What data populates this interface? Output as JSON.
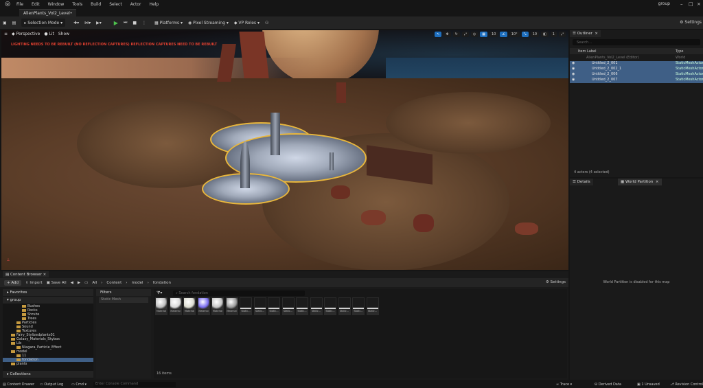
{
  "menu": [
    "File",
    "Edit",
    "Window",
    "Tools",
    "Build",
    "Select",
    "Actor",
    "Help"
  ],
  "top_right": {
    "group": "group"
  },
  "tab": {
    "level": "AlienPlants_Vol2_Level•"
  },
  "toolbar": {
    "selection_mode": "Selection Mode",
    "platforms": "Platforms",
    "pixel_streaming": "Pixel Streaming",
    "vp_roles": "VP Roles",
    "settings": "Settings"
  },
  "viewport": {
    "perspective": "Perspective",
    "lit": "Lit",
    "show": "Show",
    "warning": "LIGHTING NEEDS TO BE REBUILT (NO REFLECTION CAPTURES) REFLECTION CAPTURES NEED TO BE REBUILT",
    "grid_snap": "10",
    "rot_snap": "10°",
    "scale_snap": "10",
    "cam_speed": "1"
  },
  "outliner": {
    "title": "Outliner",
    "search_placeholder": "Search...",
    "col_label": "Item Label",
    "col_type": "Type",
    "world": "AlienPlants_Vol2_Level (Editor)",
    "world_type": "World",
    "rows": [
      {
        "name": "Untitled_2_001",
        "type": "StaticMeshActor"
      },
      {
        "name": "Untitled_2_002_1",
        "type": "StaticMeshActor"
      },
      {
        "name": "Untitled_2_006",
        "type": "StaticMeshActor"
      },
      {
        "name": "Untitled_2_007",
        "type": "StaticMeshActor"
      }
    ],
    "count": "4 actors (4 selected)"
  },
  "details": {
    "tab1": "Details",
    "tab2": "World Partition",
    "message": "World Partition is disabled for this map"
  },
  "content_browser": {
    "tab": "Content Browser",
    "add": "+ Add",
    "import": "Import",
    "save_all": "Save All",
    "path": [
      "All",
      "Content",
      "model",
      "fondation"
    ],
    "settings": "Settings",
    "favorites": "Favorites",
    "group": "group",
    "collections": "Collections",
    "filters": "Filters",
    "filter_item": "Static Mesh",
    "search_placeholder": "Search fondation",
    "items_count": "16 items",
    "tree": [
      {
        "label": "Bushes",
        "indent": 3
      },
      {
        "label": "Rocks",
        "indent": 3
      },
      {
        "label": "Shrubs",
        "indent": 3
      },
      {
        "label": "Trees",
        "indent": 3
      },
      {
        "label": "Particles",
        "indent": 2
      },
      {
        "label": "Sound",
        "indent": 2
      },
      {
        "label": "Textures",
        "indent": 2
      },
      {
        "label": "Fairy_Stylizedplants01",
        "indent": 1
      },
      {
        "label": "Galaxy_Materials_Skybox",
        "indent": 1
      },
      {
        "label": "Lib",
        "indent": 1
      },
      {
        "label": "Niagara_Particle_Effect",
        "indent": 2
      },
      {
        "label": "model",
        "indent": 1
      },
      {
        "label": "11",
        "indent": 2
      },
      {
        "label": "fondation",
        "indent": 2
      },
      {
        "label": "plants",
        "indent": 1
      }
    ],
    "tiles": [
      "Material",
      "Material",
      "Material",
      "Material",
      "Material",
      "Material",
      "Static...",
      "Static...",
      "Static...",
      "Static...",
      "Static...",
      "Static...",
      "Static...",
      "Static...",
      "Static...",
      "Static..."
    ]
  },
  "status": {
    "content_drawer": "Content Drawer",
    "output_log": "Output Log",
    "cmd": "Cmd",
    "console": "Enter Console Command",
    "trace": "Trace",
    "derived_data": "Derived Data",
    "unsaved": "1 Unsaved",
    "revision": "Revision Control"
  }
}
